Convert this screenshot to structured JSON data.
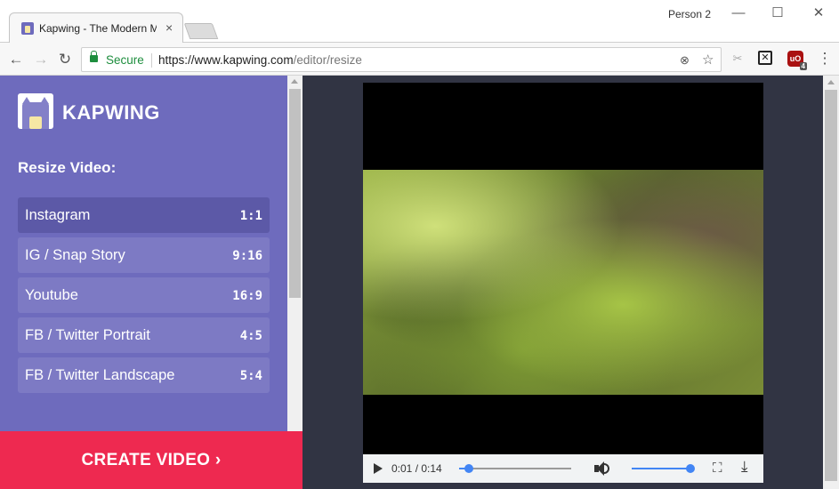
{
  "browser": {
    "tab_title": "Kapwing - The Modern M",
    "tab_close": "×",
    "profile": "Person 2",
    "window_controls": {
      "minimize": "—",
      "maximize": "☐",
      "close": "✕"
    }
  },
  "toolbar": {
    "back": "←",
    "forward": "→",
    "reload": "↻",
    "secure_label": "Secure",
    "url_host": "https://www.kapwing.com",
    "url_path": "/editor/resize",
    "star": "☆",
    "menu": "⋮",
    "ublock_badge": "4",
    "ublock_label": "uO"
  },
  "sidebar": {
    "brand": "KAPWING",
    "section_title": "Resize Video:",
    "options": [
      {
        "name": "Instagram",
        "ratio": "1:1",
        "selected": true
      },
      {
        "name": "IG / Snap Story",
        "ratio": "9:16",
        "selected": false
      },
      {
        "name": "Youtube",
        "ratio": "16:9",
        "selected": false
      },
      {
        "name": "FB / Twitter Portrait",
        "ratio": "4:5",
        "selected": false
      },
      {
        "name": "FB / Twitter Landscape",
        "ratio": "5:4",
        "selected": false
      }
    ],
    "create_button": "CREATE VIDEO ›"
  },
  "player": {
    "time": "0:01 / 0:14",
    "progress": 0.09,
    "volume": 1.0,
    "fullscreen_glyph": "⛶",
    "download_glyph": "⤓"
  },
  "colors": {
    "sidebar_bg": "#6e6bbd",
    "option_bg": "#7d7ac4",
    "option_selected_bg": "#5c59a7",
    "create_button_bg": "#ee2950",
    "stage_bg": "#313443",
    "secure_green": "#1e8e3e",
    "slider_blue": "#4285f4"
  }
}
